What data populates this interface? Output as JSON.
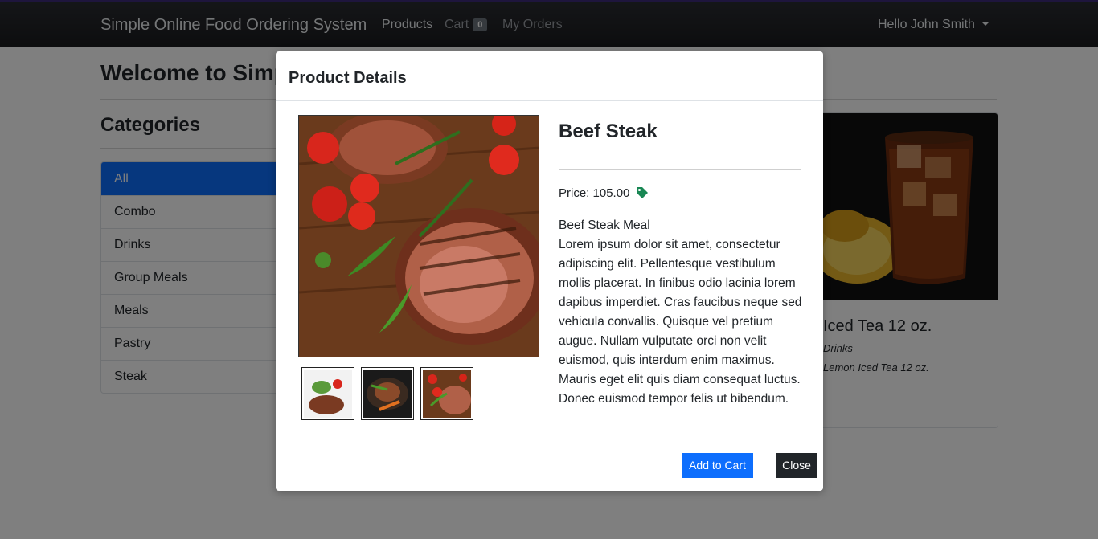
{
  "navbar": {
    "brand": "Simple Online Food Ordering System",
    "products": "Products",
    "cart": "Cart",
    "cart_count": "0",
    "my_orders": "My Orders",
    "user": "Hello John Smith"
  },
  "page": {
    "title": "Welcome to Simple Online Food Ordering System"
  },
  "categories": {
    "title": "Categories",
    "items": [
      "All",
      "Combo",
      "Drinks",
      "Group Meals",
      "Meals",
      "Pastry",
      "Steak"
    ]
  },
  "card": {
    "title": "Iced Tea 12 oz.",
    "category": "Drinks",
    "description": "Lemon Iced Tea 12 oz."
  },
  "modal": {
    "title": "Product Details",
    "product_name": "Beef Steak",
    "price": "Price: 105.00",
    "desc_heading": "Beef Steak Meal",
    "description": "Lorem ipsum dolor sit amet, consectetur adipiscing elit. Pellentesque vestibulum mollis placerat. In finibus odio lacinia lorem dapibus imperdiet. Cras faucibus neque sed vehicula convallis. Quisque vel pretium augue. Nullam vulputate orci non velit euismod, quis interdum enim maximus. Mauris eget elit quis diam consequat luctus. Donec euismod tempor felis ut bibendum.",
    "add_to_cart": "Add to Cart",
    "close": "Close"
  },
  "icons": {
    "price_tag": "tag-icon",
    "dropdown": "chevron-down-icon"
  },
  "colors": {
    "primary": "#0d6efd",
    "dark": "#212529",
    "tag": "#198754"
  }
}
